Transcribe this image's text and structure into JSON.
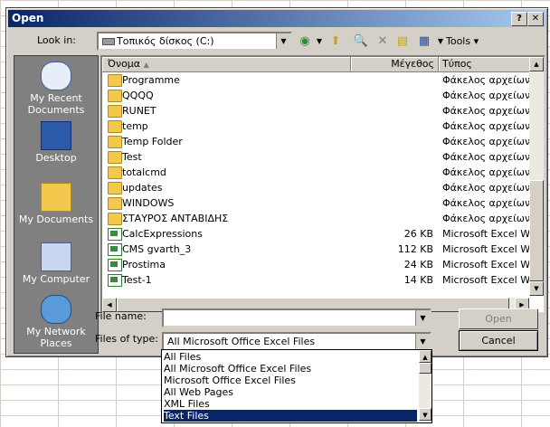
{
  "dialog": {
    "title": "Open",
    "help_btn": "?",
    "close_btn": "✕"
  },
  "lookin": {
    "label": "Look in:",
    "value": "Τοπικός δίσκος (C:)"
  },
  "toolbar": {
    "tools_label": "Tools"
  },
  "places": [
    {
      "label": "My Recent Documents",
      "icon": "recent-documents-icon"
    },
    {
      "label": "Desktop",
      "icon": "desktop-icon"
    },
    {
      "label": "My Documents",
      "icon": "my-documents-icon"
    },
    {
      "label": "My Computer",
      "icon": "my-computer-icon"
    },
    {
      "label": "My Network Places",
      "icon": "network-places-icon"
    }
  ],
  "columns": {
    "name": "Όνομα",
    "size": "Μέγεθος",
    "type": "Τύπος"
  },
  "files": [
    {
      "name": "Programme",
      "size": "",
      "type": "Φάκελος αρχείων",
      "kind": "folder"
    },
    {
      "name": "QQQQ",
      "size": "",
      "type": "Φάκελος αρχείων",
      "kind": "folder"
    },
    {
      "name": "RUNET",
      "size": "",
      "type": "Φάκελος αρχείων",
      "kind": "folder"
    },
    {
      "name": "temp",
      "size": "",
      "type": "Φάκελος αρχείων",
      "kind": "folder"
    },
    {
      "name": "Temp Folder",
      "size": "",
      "type": "Φάκελος αρχείων",
      "kind": "folder"
    },
    {
      "name": "Test",
      "size": "",
      "type": "Φάκελος αρχείων",
      "kind": "folder"
    },
    {
      "name": "totalcmd",
      "size": "",
      "type": "Φάκελος αρχείων",
      "kind": "folder"
    },
    {
      "name": "updates",
      "size": "",
      "type": "Φάκελος αρχείων",
      "kind": "folder"
    },
    {
      "name": "WINDOWS",
      "size": "",
      "type": "Φάκελος αρχείων",
      "kind": "folder"
    },
    {
      "name": "ΣΤΑΥΡΟΣ ΑΝΤΑΒΙΔΗΣ",
      "size": "",
      "type": "Φάκελος αρχείων",
      "kind": "folder"
    },
    {
      "name": "CalcExpressions",
      "size": "26 KB",
      "type": "Microsoft Excel Wor",
      "kind": "xls"
    },
    {
      "name": "CMS gvarth_3",
      "size": "112 KB",
      "type": "Microsoft Excel Wor",
      "kind": "xls"
    },
    {
      "name": "Prostima",
      "size": "24 KB",
      "type": "Microsoft Excel Wor",
      "kind": "xls"
    },
    {
      "name": "Test-1",
      "size": "14 KB",
      "type": "Microsoft Excel Wor",
      "kind": "xls"
    }
  ],
  "filename": {
    "label": "File name:",
    "value": ""
  },
  "filetype": {
    "label": "Files of type:",
    "value": "All Microsoft Office Excel Files"
  },
  "buttons": {
    "open": "Open",
    "cancel": "Cancel"
  },
  "type_options": [
    "All Files",
    "All Microsoft Office Excel Files",
    "Microsoft Office Excel Files",
    "All Web Pages",
    "XML Files",
    "Text Files"
  ],
  "selected_type_index": 5
}
